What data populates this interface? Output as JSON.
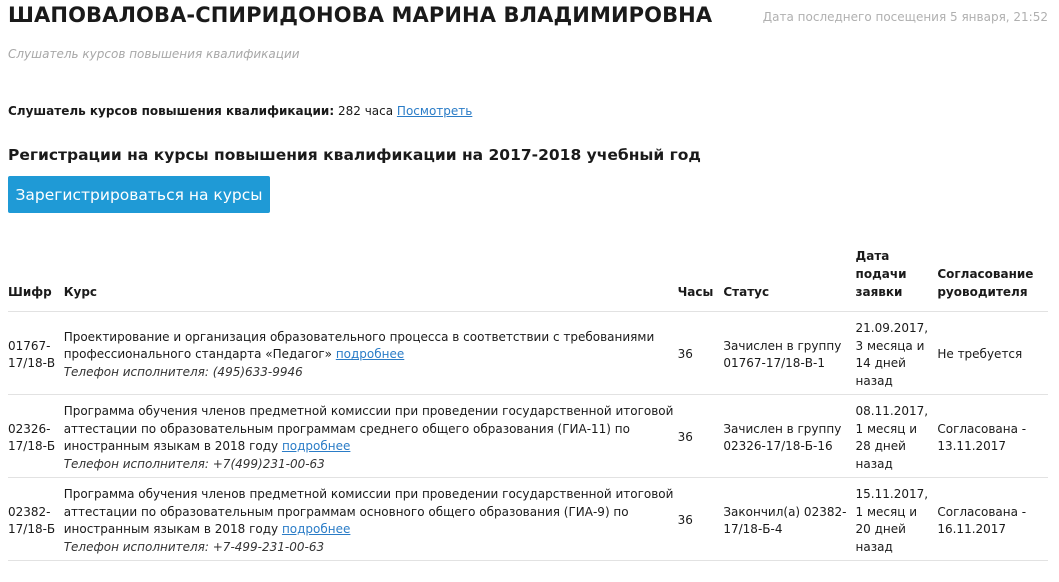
{
  "header": {
    "person_name": "ШАПОВАЛОВА-СПИРИДОНОВА МАРИНА ВЛАДИМИРОВНА",
    "last_visit": "Дата последнего посещения 5 января, 21:52",
    "role_subtitle": "Слушатель курсов повышения квалификации"
  },
  "hours_summary": {
    "label": "Слушатель курсов повышения квалификации:",
    "value": "282 часа",
    "link": "Посмотреть"
  },
  "registration": {
    "title": "Регистрации на курсы повышения квалификации на 2017-2018 учебный год",
    "button_label": "Зарегистрироваться на курсы"
  },
  "table": {
    "headers": {
      "code": "Шифр",
      "course": "Курс",
      "hours": "Часы",
      "status": "Статус",
      "date": "Дата подачи заявки",
      "approval": "Согласование руоводителя"
    },
    "rows": [
      {
        "code": "01767-17/18-В",
        "course": "Проектирование и организация образовательного процесса в соответствии с требованиями профессионального стандарта «Педагог»",
        "more_link": "подробнее",
        "phone": "Телефон исполнителя: (495)633-9946",
        "hours": "36",
        "status": "Зачислен в группу 01767-17/18-В-1",
        "date": "21.09.2017, 3 месяца и 14 дней назад",
        "approval": "Не требуется"
      },
      {
        "code": "02326-17/18-Б",
        "course": "Программа обучения членов предметной комиссии при проведении государственной итоговой аттестации по образовательным программам среднего общего образования (ГИА-11) по иностранным языкам в 2018 году",
        "more_link": "подробнее",
        "phone": "Телефон исполнителя: +7(499)231-00-63",
        "hours": "36",
        "status": "Зачислен в группу 02326-17/18-Б-16",
        "date": "08.11.2017, 1 месяц и 28 дней назад",
        "approval": "Согласована - 13.11.2017"
      },
      {
        "code": "02382-17/18-Б",
        "course": "Программа обучения членов предметной комиссии при проведении государственной итоговой аттестации по образовательным программам основного общего образования (ГИА-9) по иностранным языкам в 2018 году",
        "more_link": "подробнее",
        "phone": "Телефон исполнителя: +7-499-231-00-63",
        "hours": "36",
        "status": "Закончил(а) 02382-17/18-Б-4",
        "date": "15.11.2017, 1 месяц и 20 дней назад",
        "approval": "Согласована - 16.11.2017"
      }
    ]
  },
  "colors": {
    "button_bg": "#1f9ad6",
    "link": "#2a7cc7",
    "muted_text": "#b0b0b0"
  }
}
